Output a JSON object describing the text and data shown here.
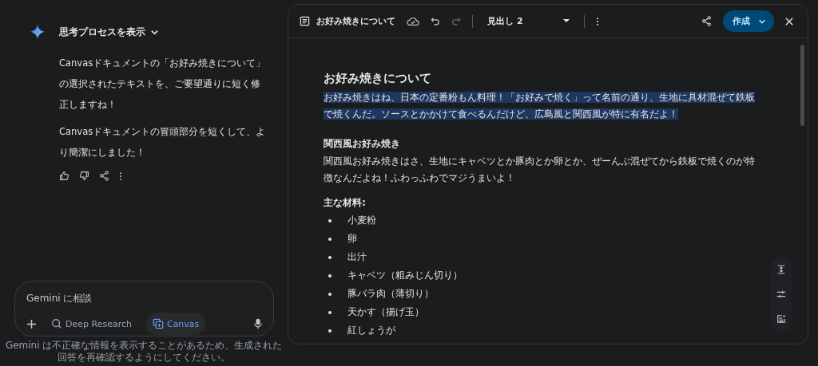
{
  "chat": {
    "thinking_toggle": {
      "label": "思考プロセスを表示",
      "expanded": false
    },
    "messages": [
      "Canvasドキュメントの「お好み焼きについて」の選択されたテキストを、ご要望通りに短く修正しますね！",
      "Canvasドキュメントの冒頭部分を短くして、より簡潔にしました！"
    ]
  },
  "prompt": {
    "placeholder": "Gemini に相談",
    "tools": [
      {
        "label": "Deep Research",
        "selected": false
      },
      {
        "label": "Canvas",
        "selected": true
      }
    ]
  },
  "disclaimer": "Gemini は不正確な情報を表示することがあるため、生成された回答を再確認するようにしてください。",
  "canvas": {
    "title": "お好み焼きについて",
    "style_dropdown": "見出し 2",
    "create_button": "作成",
    "document": {
      "heading": "お好み焼きについて",
      "intro": {
        "text": "お好み焼きはね、日本の定番粉もん料理！「お好みで焼く」って名前の通り、生地に具材混ぜて鉄板で焼くんだ。ソースとかかけて食べるんだけど、広島風と関西風が特に有名だよ！",
        "selected": true
      },
      "section_heading": "関西風お好み焼き",
      "section_text": "関西風お好み焼きはさ、生地にキャベツとか豚肉とか卵とか、ぜーんぶ混ぜてから鉄板で焼くのが特徴なんだよね！ふわっふわでマジうまいよ！",
      "list_heading": "主な材料:",
      "list_items": [
        "小麦粉",
        "卵",
        "出汁",
        "キャベツ（粗みじん切り）",
        "豚バラ肉（薄切り）",
        "天かす（揚げ玉）",
        "紅しょうが"
      ]
    }
  }
}
